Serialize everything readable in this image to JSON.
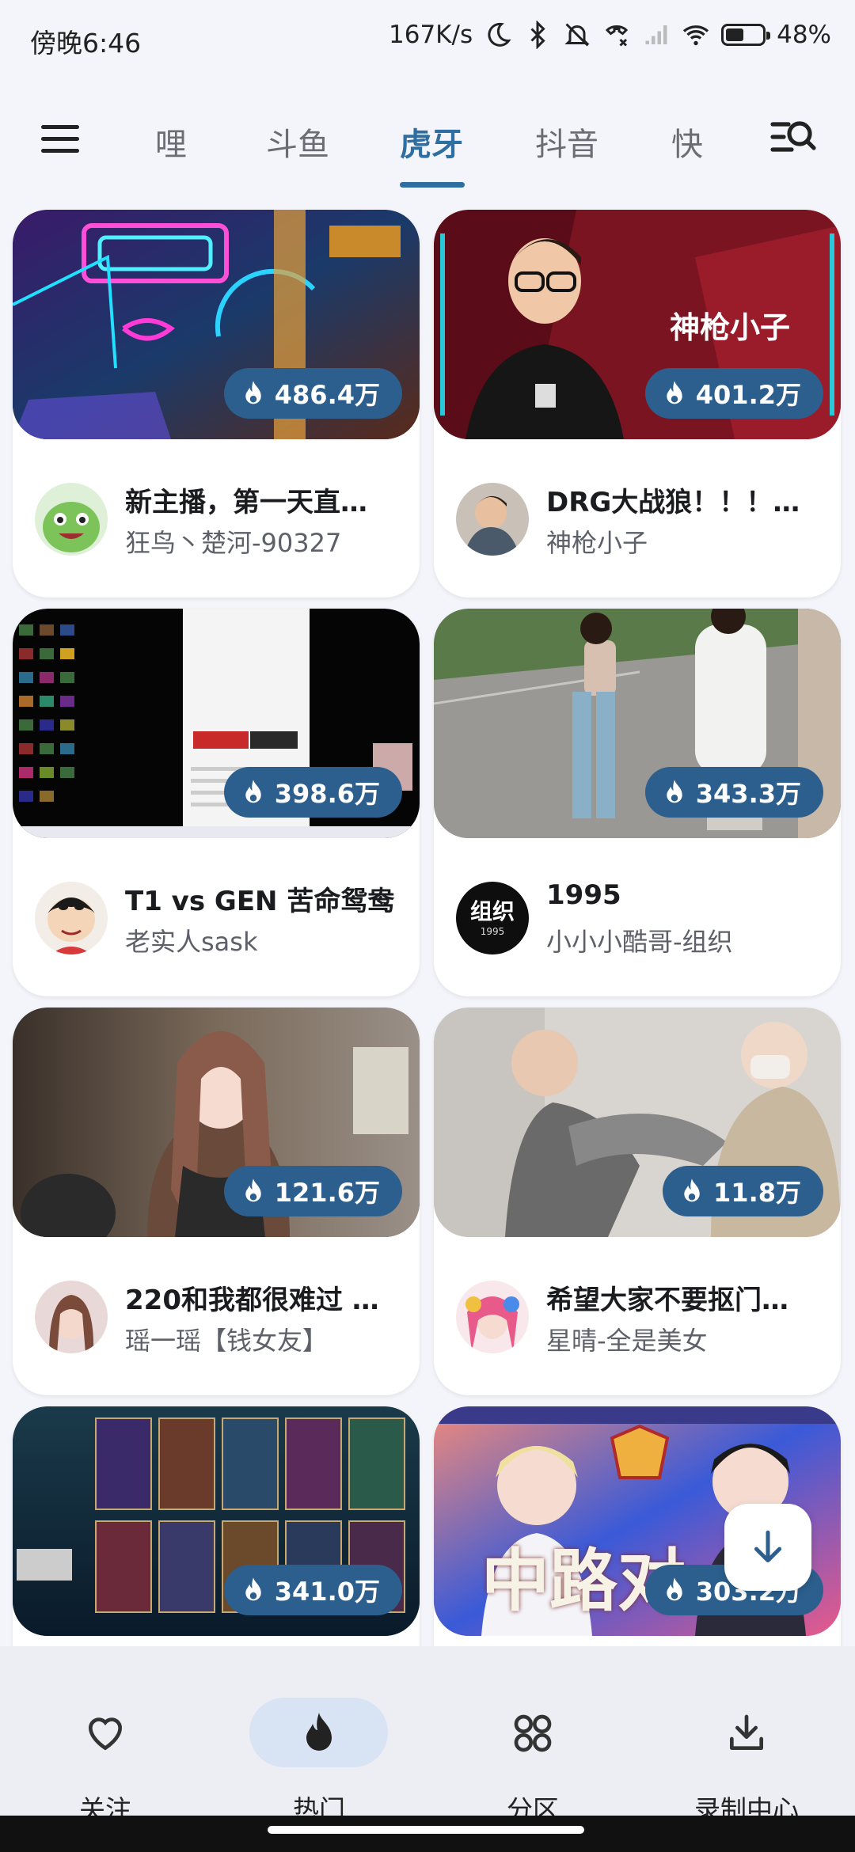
{
  "status_bar": {
    "time": "傍晚6:46",
    "speed": "167K/s",
    "battery": "48%"
  },
  "tabs": [
    "哩",
    "斗鱼",
    "虎牙",
    "抖音",
    "快"
  ],
  "active_tab": "虎牙",
  "accent_color": "#2f6ea0",
  "cards": [
    {
      "title": "新主播，第一天直…",
      "streamer": "狂鸟丶楚河-90327",
      "heat": "486.4万"
    },
    {
      "title": "DRG大战狼！！！…",
      "streamer": "神枪小子",
      "heat": "401.2万",
      "overlay": "神枪小子"
    },
    {
      "title": "T1 vs GEN 苦命鸳鸯",
      "streamer": "老实人sask",
      "heat": "398.6万"
    },
    {
      "title": "1995",
      "streamer": "小小小酷哥-组织",
      "heat": "343.3万",
      "avatar_text": "组织",
      "avatar_sub": "1995"
    },
    {
      "title": "220和我都很难过 …",
      "streamer": "瑶一瑶【钱女友】",
      "heat": "121.6万"
    },
    {
      "title": "希望大家不要抠门…",
      "streamer": "星晴-全是美女",
      "heat": "11.8万"
    },
    {
      "title": "",
      "streamer": "",
      "heat": "341.0万"
    },
    {
      "title": "",
      "streamer": "",
      "heat": "303.2万",
      "overlay": "中路对"
    }
  ],
  "nav": [
    {
      "label": "关注",
      "icon": "heart-icon"
    },
    {
      "label": "热门",
      "icon": "flame-icon"
    },
    {
      "label": "分区",
      "icon": "grid-circles-icon"
    },
    {
      "label": "录制中心",
      "icon": "download-tray-icon"
    }
  ]
}
